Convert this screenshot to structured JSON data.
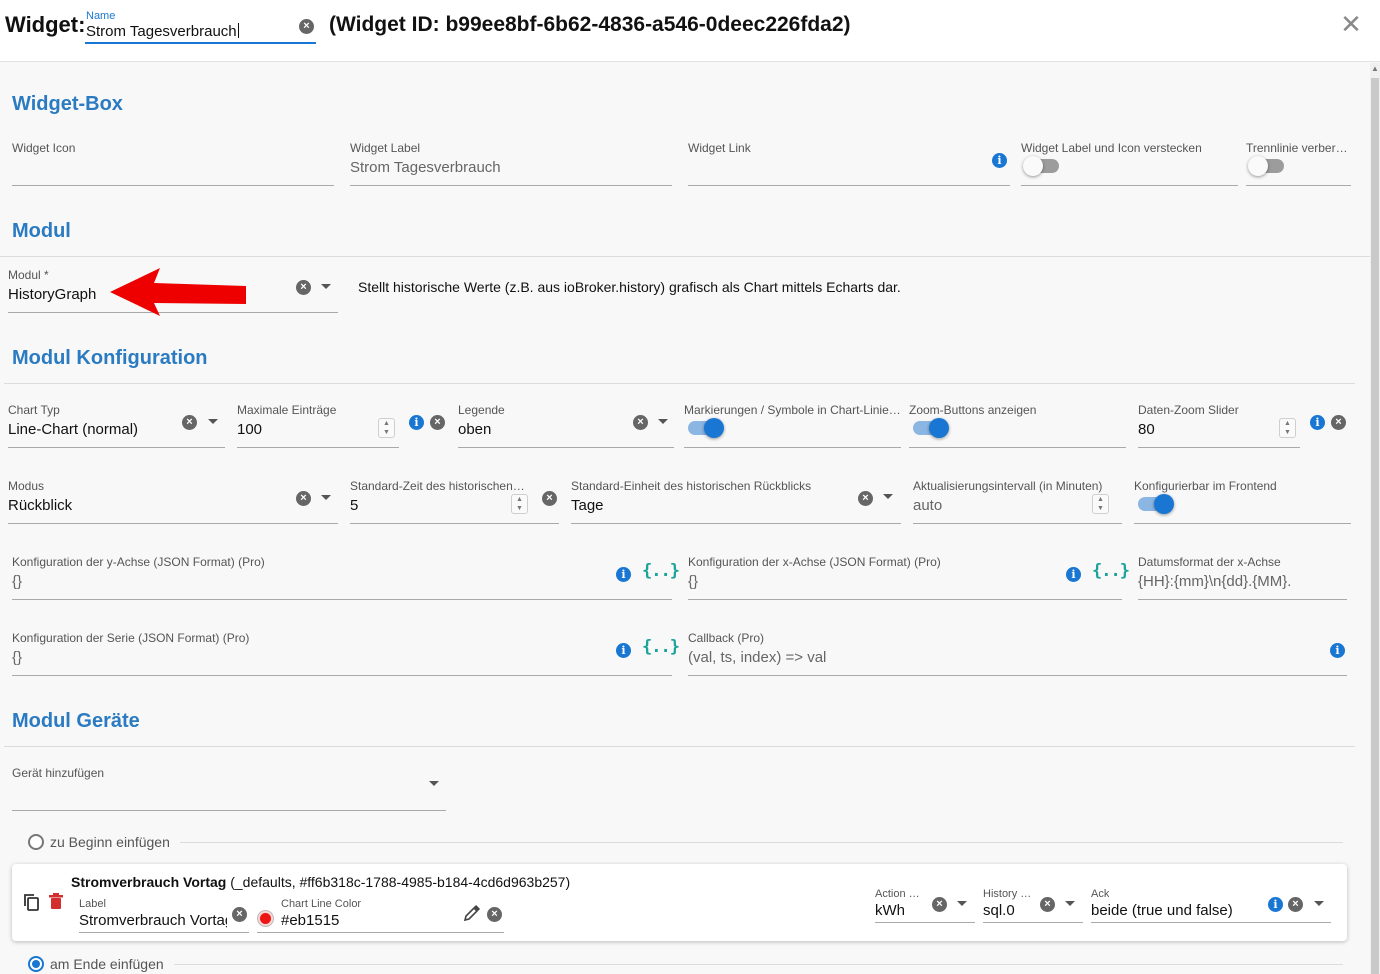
{
  "header": {
    "widget_label": "Widget:",
    "name_label": "Name",
    "name_value": "Strom Tagesverbrauch",
    "widget_id_text": "(Widget ID: b99ee8bf-6b62-4836-a546-0deec226fda2)",
    "close_icon": "close-icon"
  },
  "widget_box": {
    "title": "Widget-Box",
    "fields": {
      "icon": {
        "label": "Widget Icon",
        "value": ""
      },
      "label": {
        "label": "Widget Label",
        "value": "Strom Tagesverbrauch"
      },
      "link": {
        "label": "Widget Link",
        "value": ""
      },
      "hide_label_icon": {
        "label": "Widget Label und Icon verstecken",
        "checked": false
      },
      "hide_divider": {
        "label": "Trennlinie verber…",
        "checked": false
      }
    }
  },
  "modul": {
    "title": "Modul",
    "field": {
      "label": "Modul *",
      "value": "HistoryGraph"
    },
    "description": "Stellt historische Werte (z.B. aus ioBroker.history) grafisch als Chart mittels Echarts dar."
  },
  "modul_konfiguration": {
    "title": "Modul Konfiguration",
    "chart_typ": {
      "label": "Chart Typ",
      "value": "Line-Chart (normal)"
    },
    "max_entries": {
      "label": "Maximale Einträge",
      "value": "100"
    },
    "legende": {
      "label": "Legende",
      "value": "oben"
    },
    "markers": {
      "label": "Markierungen / Symbole in Chart-Linie…",
      "checked": true
    },
    "zoom_buttons": {
      "label": "Zoom-Buttons anzeigen",
      "checked": true
    },
    "zoom_slider": {
      "label": "Daten-Zoom Slider",
      "value": "80"
    },
    "modus": {
      "label": "Modus",
      "value": "Rückblick"
    },
    "std_zeit": {
      "label": "Standard-Zeit des historischen …",
      "value": "5"
    },
    "std_einheit": {
      "label": "Standard-Einheit des historischen Rückblicks",
      "value": "Tage"
    },
    "interval": {
      "label": "Aktualisierungsintervall (in Minuten)",
      "value": "auto"
    },
    "frontend": {
      "label": "Konfigurierbar im Frontend",
      "checked": true
    },
    "y_axis": {
      "label": "Konfiguration der y-Achse (JSON Format) (Pro)",
      "value": "{}"
    },
    "x_axis": {
      "label": "Konfiguration der x-Achse (JSON Format) (Pro)",
      "value": "{}"
    },
    "date_format": {
      "label": "Datumsformat der x-Achse",
      "value": "{HH}:{mm}\\n{dd}.{MM}."
    },
    "series": {
      "label": "Konfiguration der Serie (JSON Format) (Pro)",
      "value": "{}"
    },
    "callback": {
      "label": "Callback (Pro)",
      "value": "(val, ts, index) => val"
    },
    "json_button_text": "{..}"
  },
  "modul_geraete": {
    "title": "Modul Geräte",
    "add_device": {
      "label": "Gerät hinzufügen",
      "value": ""
    },
    "insert_start": "zu Beginn einfügen",
    "insert_end": "am Ende einfügen",
    "device": {
      "name": "Stromverbrauch Vortag",
      "meta": " (_defaults, #ff6b318c-1788-4985-b184-4cd6d963b257)",
      "label_field": {
        "label": "Label",
        "value": "Stromverbrauch Vortag"
      },
      "color_field": {
        "label": "Chart Line Color",
        "value": "#eb1515"
      },
      "action_field": {
        "label": "Action S…",
        "value": "kWh"
      },
      "history_field": {
        "label": "History …",
        "value": "sql.0"
      },
      "ack_field": {
        "label": "Ack",
        "value": "beide (true und false)"
      }
    }
  },
  "colors": {
    "accent": "#1976d2",
    "section_title": "#2a7bc1",
    "annotation_arrow": "#ee0000",
    "line_color_swatch": "#eb1515"
  }
}
